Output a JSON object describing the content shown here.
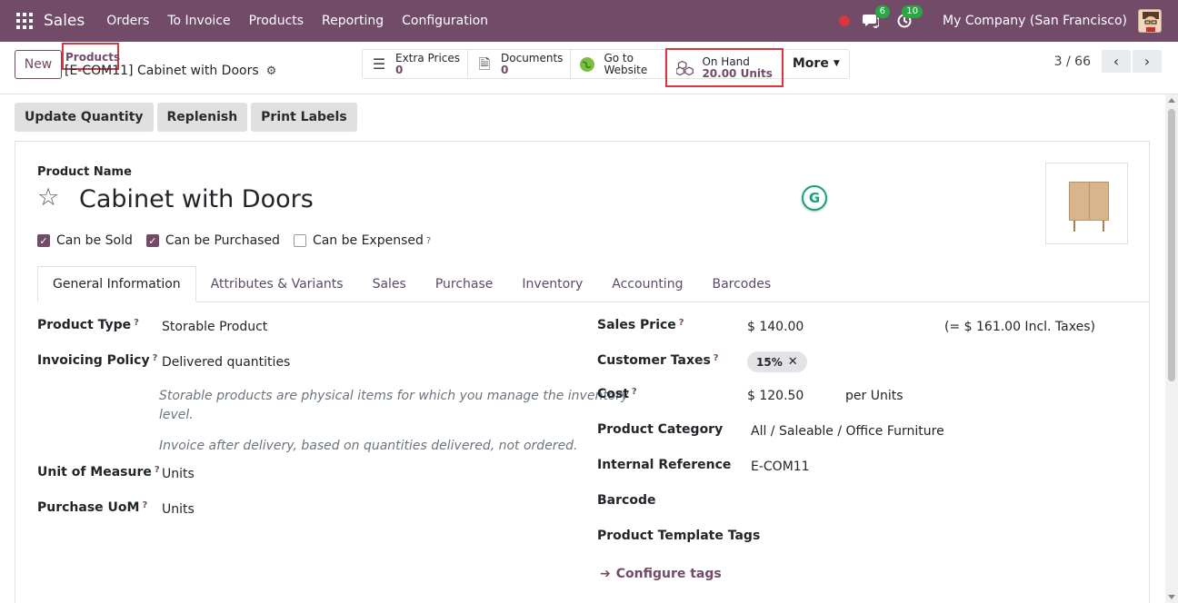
{
  "navbar": {
    "brand": "Sales",
    "menu": [
      "Orders",
      "To Invoice",
      "Products",
      "Reporting",
      "Configuration"
    ],
    "messages_count": "6",
    "activities_count": "10",
    "company": "My Company (San Francisco)"
  },
  "control": {
    "new_label": "New",
    "breadcrumb_parent": "Products",
    "record_name": "[E-COM11] Cabinet with Doors",
    "smart_buttons": {
      "extra_prices": {
        "label": "Extra Prices",
        "value": "0"
      },
      "documents": {
        "label": "Documents",
        "value": "0"
      },
      "website": {
        "line1": "Go to",
        "line2": "Website"
      },
      "on_hand": {
        "label": "On Hand",
        "value": "20.00 Units"
      },
      "more": "More"
    },
    "pager": "3 / 66"
  },
  "actions": {
    "update_quantity": "Update Quantity",
    "replenish": "Replenish",
    "print_labels": "Print Labels"
  },
  "product": {
    "name_label": "Product Name",
    "name": "Cabinet with Doors",
    "can_be_sold": "Can be Sold",
    "can_be_purchased": "Can be Purchased",
    "can_be_expensed": "Can be Expensed"
  },
  "tabs": [
    "General Information",
    "Attributes & Variants",
    "Sales",
    "Purchase",
    "Inventory",
    "Accounting",
    "Barcodes"
  ],
  "general": {
    "product_type_label": "Product Type",
    "product_type": "Storable Product",
    "invoicing_policy_label": "Invoicing Policy",
    "invoicing_policy": "Delivered quantities",
    "note_storable_1": "Storable products are physical items for which you manage the inventory",
    "note_storable_2": "level.",
    "note_invoice": "Invoice after delivery, based on quantities delivered, not ordered.",
    "uom_label": "Unit of Measure",
    "uom": "Units",
    "purchase_uom_label": "Purchase UoM",
    "purchase_uom": "Units",
    "sales_price_label": "Sales Price",
    "sales_price": "$ 140.00",
    "sales_price_incl": "(= $ 161.00 Incl. Taxes)",
    "customer_taxes_label": "Customer Taxes",
    "tax_tag": "15%",
    "cost_label": "Cost",
    "cost": "$ 120.50",
    "cost_per": "per Units",
    "category_label": "Product Category",
    "category": "All / Saleable / Office Furniture",
    "internal_ref_label": "Internal Reference",
    "internal_ref": "E-COM11",
    "barcode_label": "Barcode",
    "tags_label": "Product Template Tags",
    "configure_tags": "Configure tags"
  },
  "help_mark": "?"
}
